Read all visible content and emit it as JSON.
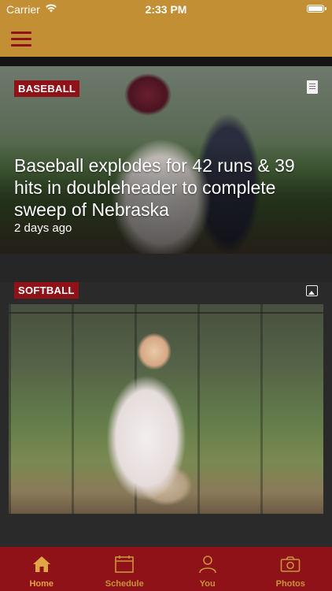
{
  "status_bar": {
    "carrier": "Carrier",
    "time": "2:33 PM"
  },
  "theme": {
    "gold": "#c28f35",
    "maroon": "#8e1218",
    "tab_icon_color": "#c9943c"
  },
  "nav": {
    "menu_icon": "hamburger-menu-icon"
  },
  "feed": [
    {
      "category": "BASEBALL",
      "title": "Baseball explodes for 42 runs & 39 hits in doubleheader to complete sweep of Nebraska",
      "time_ago": "2 days ago",
      "type_icon": "article-icon"
    },
    {
      "category": "SOFTBALL",
      "type_icon": "photo-gallery-icon"
    }
  ],
  "tabs": [
    {
      "label": "Home",
      "icon": "home-icon",
      "active": true
    },
    {
      "label": "Schedule",
      "icon": "calendar-icon",
      "active": false
    },
    {
      "label": "You",
      "icon": "person-icon",
      "active": false
    },
    {
      "label": "Photos",
      "icon": "camera-icon",
      "active": false
    }
  ]
}
